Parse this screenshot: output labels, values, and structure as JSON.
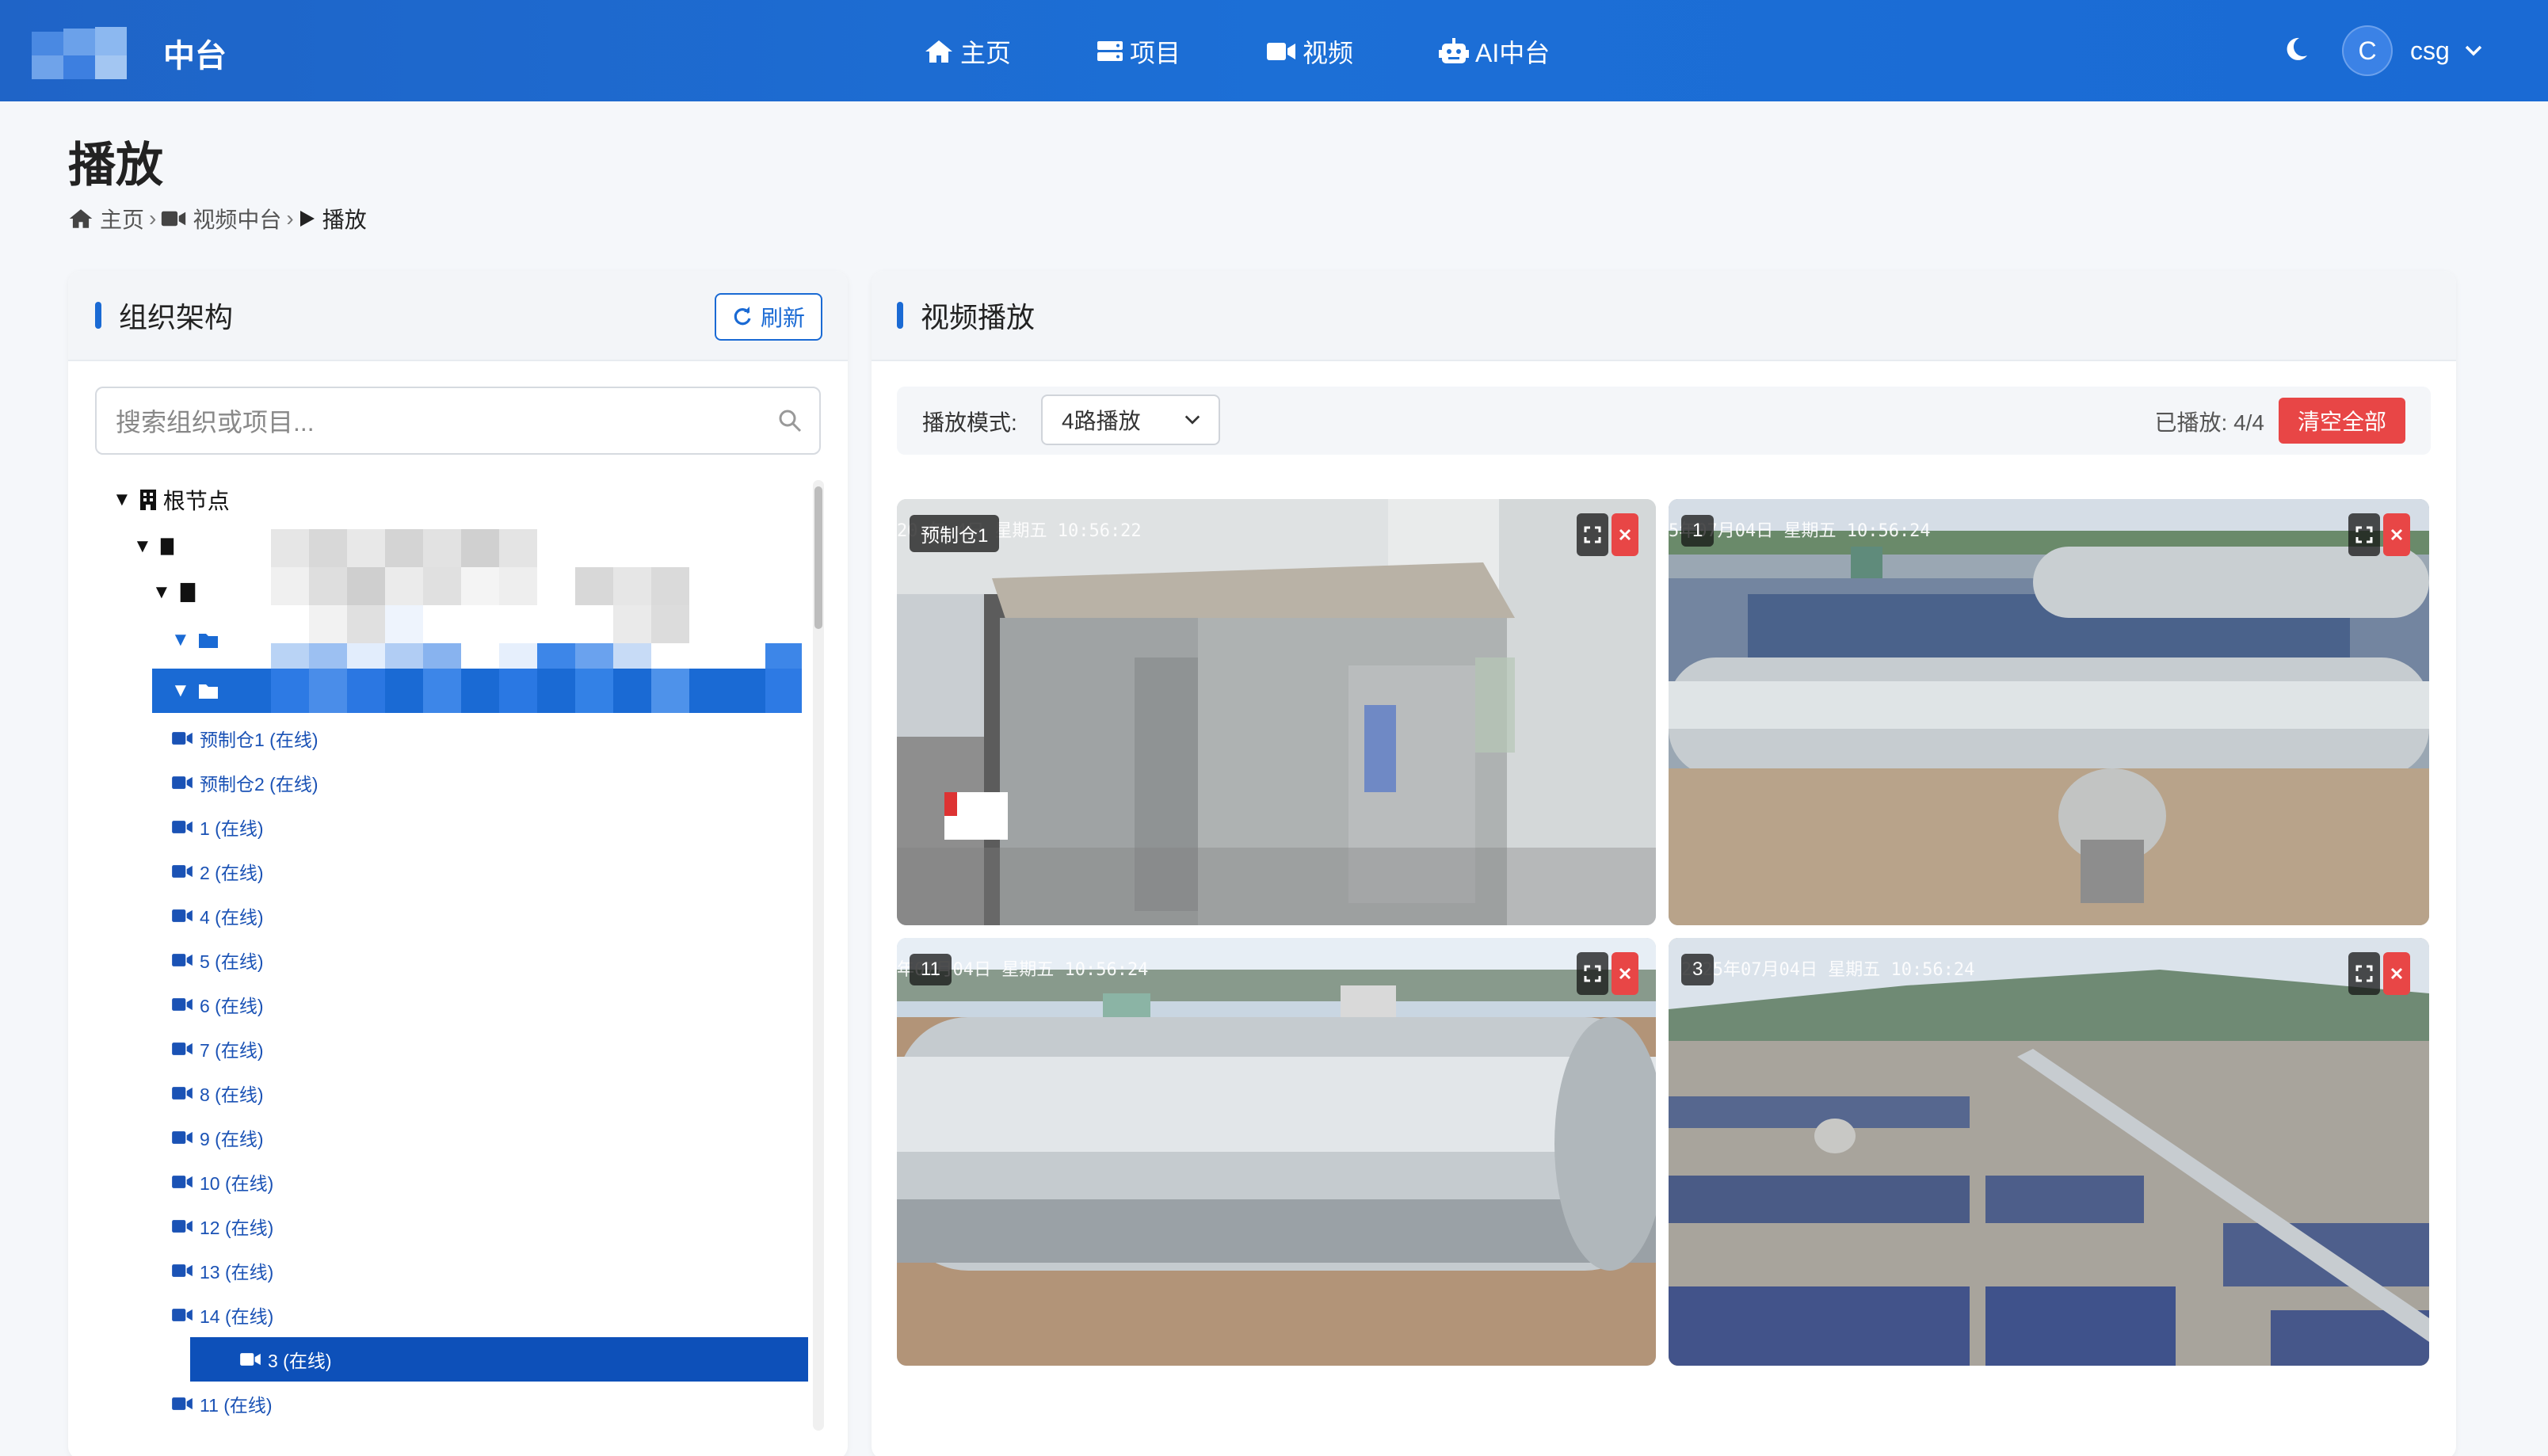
{
  "header": {
    "brand_suffix": "中台",
    "nav": [
      {
        "label": "主页",
        "icon": "home-icon"
      },
      {
        "label": "项目",
        "icon": "server-icon"
      },
      {
        "label": "视频",
        "icon": "video-camera-icon"
      },
      {
        "label": "AI中台",
        "icon": "robot-icon"
      }
    ],
    "user": {
      "avatar_letter": "C",
      "name": "csg"
    }
  },
  "page": {
    "title": "播放",
    "breadcrumb": [
      {
        "label": "主页",
        "icon": "home-icon"
      },
      {
        "label": "视频中台",
        "icon": "video-camera-icon"
      },
      {
        "label": "播放",
        "icon": "play-icon"
      }
    ]
  },
  "org_panel": {
    "title": "组织架构",
    "refresh_label": "刷新",
    "search_placeholder": "搜索组织或项目...",
    "root_label": "根节点",
    "devices": [
      {
        "label": "预制仓1 (在线)",
        "selected": false
      },
      {
        "label": "预制仓2 (在线)",
        "selected": false
      },
      {
        "label": "1 (在线)",
        "selected": false
      },
      {
        "label": "2 (在线)",
        "selected": false
      },
      {
        "label": "4 (在线)",
        "selected": false
      },
      {
        "label": "5 (在线)",
        "selected": false
      },
      {
        "label": "6 (在线)",
        "selected": false
      },
      {
        "label": "7 (在线)",
        "selected": false
      },
      {
        "label": "8 (在线)",
        "selected": false
      },
      {
        "label": "9 (在线)",
        "selected": false
      },
      {
        "label": "10 (在线)",
        "selected": false
      },
      {
        "label": "12 (在线)",
        "selected": false
      },
      {
        "label": "13 (在线)",
        "selected": false
      },
      {
        "label": "14 (在线)",
        "selected": false
      },
      {
        "label": "3 (在线)",
        "selected": true
      },
      {
        "label": "11 (在线)",
        "selected": false
      }
    ]
  },
  "video_panel": {
    "title": "视频播放",
    "mode_label": "播放模式:",
    "mode_value": "4路播放",
    "played_text": "已播放: 4/4",
    "clear_label": "清空全部",
    "streams": [
      {
        "label": "预制仓1",
        "timestamp": "20  年  4日  星期五  10:56:22"
      },
      {
        "label": "1",
        "timestamp": "  5年07月04日  星期五  10:56:24"
      },
      {
        "label": "11",
        "timestamp": "  年07月04日  星期五  10:56:24"
      },
      {
        "label": "3",
        "timestamp": "2025年07月04日  星期五  10:56:24"
      }
    ]
  },
  "colors": {
    "header": "#1c6fd6",
    "accent": "#1a6ad4",
    "danger": "#e84646",
    "selected": "#0d50b9"
  }
}
